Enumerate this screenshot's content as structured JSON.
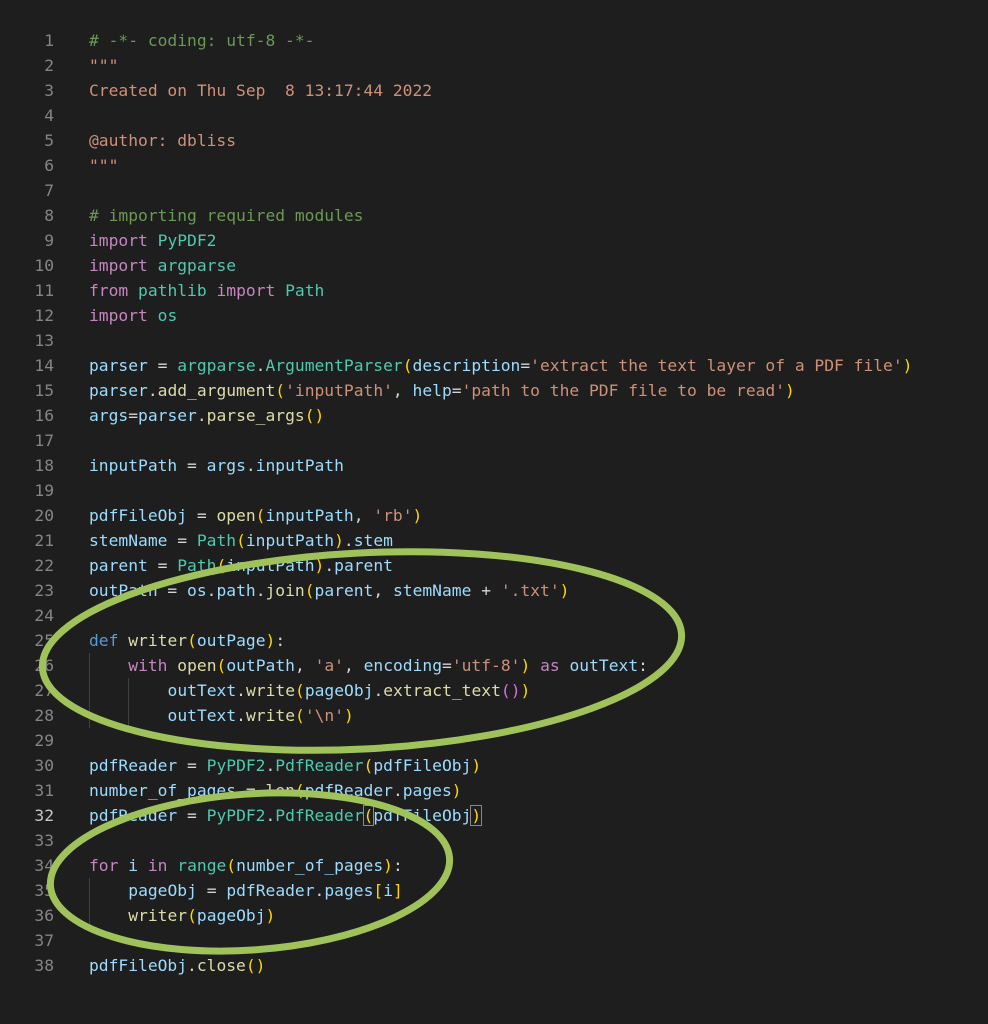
{
  "editor": {
    "active_line": 32,
    "lines": [
      {
        "n": "1",
        "indent": 0,
        "t": [
          [
            "# -*- coding: utf-8 -*-",
            "comment"
          ]
        ]
      },
      {
        "n": "2",
        "indent": 0,
        "t": [
          [
            "\"\"\"",
            "str"
          ]
        ]
      },
      {
        "n": "3",
        "indent": 0,
        "t": [
          [
            "Created on Thu Sep  8 13:17:44 2022",
            "str"
          ]
        ]
      },
      {
        "n": "4",
        "indent": 0,
        "t": []
      },
      {
        "n": "5",
        "indent": 0,
        "t": [
          [
            "@author: dbliss",
            "str"
          ]
        ]
      },
      {
        "n": "6",
        "indent": 0,
        "t": [
          [
            "\"\"\"",
            "str"
          ]
        ]
      },
      {
        "n": "7",
        "indent": 0,
        "t": []
      },
      {
        "n": "8",
        "indent": 0,
        "t": [
          [
            "# importing required modules",
            "comment"
          ]
        ]
      },
      {
        "n": "9",
        "indent": 0,
        "t": [
          [
            "import",
            "kw"
          ],
          [
            " ",
            "op"
          ],
          [
            "PyPDF2",
            "mod"
          ]
        ]
      },
      {
        "n": "10",
        "indent": 0,
        "t": [
          [
            "import",
            "kw"
          ],
          [
            " ",
            "op"
          ],
          [
            "argparse",
            "mod"
          ]
        ]
      },
      {
        "n": "11",
        "indent": 0,
        "t": [
          [
            "from",
            "kw"
          ],
          [
            " ",
            "op"
          ],
          [
            "pathlib",
            "mod"
          ],
          [
            " ",
            "op"
          ],
          [
            "import",
            "kw"
          ],
          [
            " ",
            "op"
          ],
          [
            "Path",
            "mod"
          ]
        ]
      },
      {
        "n": "12",
        "indent": 0,
        "t": [
          [
            "import",
            "kw"
          ],
          [
            " ",
            "op"
          ],
          [
            "os",
            "mod"
          ]
        ]
      },
      {
        "n": "13",
        "indent": 0,
        "t": []
      },
      {
        "n": "14",
        "indent": 0,
        "t": [
          [
            "parser",
            "var"
          ],
          [
            " = ",
            "op"
          ],
          [
            "argparse",
            "mod"
          ],
          [
            ".",
            "op"
          ],
          [
            "ArgumentParser",
            "mod"
          ],
          [
            "(",
            "p1"
          ],
          [
            "description",
            "var"
          ],
          [
            "=",
            "op"
          ],
          [
            "'extract the text layer of a PDF file'",
            "str"
          ],
          [
            ")",
            "p1"
          ]
        ]
      },
      {
        "n": "15",
        "indent": 0,
        "t": [
          [
            "parser",
            "var"
          ],
          [
            ".",
            "op"
          ],
          [
            "add_argument",
            "fn"
          ],
          [
            "(",
            "p1"
          ],
          [
            "'inputPath'",
            "str"
          ],
          [
            ", ",
            "op"
          ],
          [
            "help",
            "var"
          ],
          [
            "=",
            "op"
          ],
          [
            "'path to the PDF file to be read'",
            "str"
          ],
          [
            ")",
            "p1"
          ]
        ]
      },
      {
        "n": "16",
        "indent": 0,
        "t": [
          [
            "args",
            "var"
          ],
          [
            "=",
            "op"
          ],
          [
            "parser",
            "var"
          ],
          [
            ".",
            "op"
          ],
          [
            "parse_args",
            "fn"
          ],
          [
            "()",
            "p1"
          ]
        ]
      },
      {
        "n": "17",
        "indent": 0,
        "t": []
      },
      {
        "n": "18",
        "indent": 0,
        "t": [
          [
            "inputPath",
            "var"
          ],
          [
            " = ",
            "op"
          ],
          [
            "args",
            "var"
          ],
          [
            ".",
            "op"
          ],
          [
            "inputPath",
            "var"
          ]
        ]
      },
      {
        "n": "19",
        "indent": 0,
        "t": []
      },
      {
        "n": "20",
        "indent": 0,
        "t": [
          [
            "pdfFileObj",
            "var"
          ],
          [
            " = ",
            "op"
          ],
          [
            "open",
            "fn"
          ],
          [
            "(",
            "p1"
          ],
          [
            "inputPath",
            "var"
          ],
          [
            ", ",
            "op"
          ],
          [
            "'rb'",
            "str"
          ],
          [
            ")",
            "p1"
          ]
        ]
      },
      {
        "n": "21",
        "indent": 0,
        "t": [
          [
            "stemName",
            "var"
          ],
          [
            " = ",
            "op"
          ],
          [
            "Path",
            "mod"
          ],
          [
            "(",
            "p1"
          ],
          [
            "inputPath",
            "var"
          ],
          [
            ")",
            "p1"
          ],
          [
            ".",
            "op"
          ],
          [
            "stem",
            "var"
          ]
        ]
      },
      {
        "n": "22",
        "indent": 0,
        "t": [
          [
            "parent",
            "var"
          ],
          [
            " = ",
            "op"
          ],
          [
            "Path",
            "mod"
          ],
          [
            "(",
            "p1"
          ],
          [
            "inputPath",
            "var"
          ],
          [
            ")",
            "p1"
          ],
          [
            ".",
            "op"
          ],
          [
            "parent",
            "var"
          ]
        ]
      },
      {
        "n": "23",
        "indent": 0,
        "t": [
          [
            "outPath",
            "var"
          ],
          [
            " = ",
            "op"
          ],
          [
            "os",
            "var"
          ],
          [
            ".",
            "op"
          ],
          [
            "path",
            "var"
          ],
          [
            ".",
            "op"
          ],
          [
            "join",
            "fn"
          ],
          [
            "(",
            "p1"
          ],
          [
            "parent",
            "var"
          ],
          [
            ", ",
            "op"
          ],
          [
            "stemName",
            "var"
          ],
          [
            " + ",
            "op"
          ],
          [
            "'.txt'",
            "str"
          ],
          [
            ")",
            "p1"
          ]
        ]
      },
      {
        "n": "24",
        "indent": 0,
        "t": []
      },
      {
        "n": "25",
        "indent": 0,
        "t": [
          [
            "def",
            "def"
          ],
          [
            " ",
            "op"
          ],
          [
            "writer",
            "fn"
          ],
          [
            "(",
            "p1"
          ],
          [
            "outPage",
            "var"
          ],
          [
            ")",
            "p1"
          ],
          [
            ":",
            "op"
          ]
        ]
      },
      {
        "n": "26",
        "indent": 1,
        "t": [
          [
            "with",
            "kw"
          ],
          [
            " ",
            "op"
          ],
          [
            "open",
            "fn"
          ],
          [
            "(",
            "p1"
          ],
          [
            "outPath",
            "var"
          ],
          [
            ", ",
            "op"
          ],
          [
            "'a'",
            "str"
          ],
          [
            ", ",
            "op"
          ],
          [
            "encoding",
            "var"
          ],
          [
            "=",
            "op"
          ],
          [
            "'utf-8'",
            "str"
          ],
          [
            ")",
            "p1"
          ],
          [
            " ",
            "op"
          ],
          [
            "as",
            "kw"
          ],
          [
            " ",
            "op"
          ],
          [
            "outText",
            "var"
          ],
          [
            ":",
            "op"
          ]
        ]
      },
      {
        "n": "27",
        "indent": 2,
        "t": [
          [
            "outText",
            "var"
          ],
          [
            ".",
            "op"
          ],
          [
            "write",
            "fn"
          ],
          [
            "(",
            "p1"
          ],
          [
            "pageObj",
            "var"
          ],
          [
            ".",
            "op"
          ],
          [
            "extract_text",
            "fn"
          ],
          [
            "()",
            "p2"
          ],
          [
            ")",
            "p1"
          ]
        ]
      },
      {
        "n": "28",
        "indent": 2,
        "t": [
          [
            "outText",
            "var"
          ],
          [
            ".",
            "op"
          ],
          [
            "write",
            "fn"
          ],
          [
            "(",
            "p1"
          ],
          [
            "'\\n'",
            "str"
          ],
          [
            ")",
            "p1"
          ]
        ]
      },
      {
        "n": "29",
        "indent": 0,
        "t": []
      },
      {
        "n": "30",
        "indent": 0,
        "t": [
          [
            "pdfReader",
            "var"
          ],
          [
            " = ",
            "op"
          ],
          [
            "PyPDF2",
            "mod"
          ],
          [
            ".",
            "op"
          ],
          [
            "PdfReader",
            "mod"
          ],
          [
            "(",
            "p1"
          ],
          [
            "pdfFileObj",
            "var"
          ],
          [
            ")",
            "p1"
          ]
        ]
      },
      {
        "n": "31",
        "indent": 0,
        "t": [
          [
            "number_of_pages",
            "var"
          ],
          [
            " = ",
            "op"
          ],
          [
            "len",
            "fn"
          ],
          [
            "(",
            "p1"
          ],
          [
            "pdfReader",
            "var"
          ],
          [
            ".",
            "op"
          ],
          [
            "pages",
            "var"
          ],
          [
            ")",
            "p1"
          ]
        ]
      },
      {
        "n": "32",
        "indent": 0,
        "t": [
          [
            "pdfReader",
            "var"
          ],
          [
            " = ",
            "op"
          ],
          [
            "PyPDF2",
            "mod"
          ],
          [
            ".",
            "op"
          ],
          [
            "PdfReader",
            "mod"
          ],
          [
            "(",
            "p1bm"
          ],
          [
            "pdfFileObj",
            "var"
          ],
          [
            ")",
            "p1bm"
          ]
        ]
      },
      {
        "n": "33",
        "indent": 0,
        "t": []
      },
      {
        "n": "34",
        "indent": 0,
        "t": [
          [
            "for",
            "kw"
          ],
          [
            " ",
            "op"
          ],
          [
            "i",
            "var"
          ],
          [
            " ",
            "op"
          ],
          [
            "in",
            "kw"
          ],
          [
            " ",
            "op"
          ],
          [
            "range",
            "mod"
          ],
          [
            "(",
            "p1"
          ],
          [
            "number_of_pages",
            "var"
          ],
          [
            ")",
            "p1"
          ],
          [
            ":",
            "op"
          ]
        ]
      },
      {
        "n": "35",
        "indent": 1,
        "t": [
          [
            "pageObj",
            "var"
          ],
          [
            " = ",
            "op"
          ],
          [
            "pdfReader",
            "var"
          ],
          [
            ".",
            "op"
          ],
          [
            "pages",
            "var"
          ],
          [
            "[",
            "p1"
          ],
          [
            "i",
            "var"
          ],
          [
            "]",
            "p1"
          ]
        ]
      },
      {
        "n": "36",
        "indent": 1,
        "t": [
          [
            "writer",
            "fn"
          ],
          [
            "(",
            "p1"
          ],
          [
            "pageObj",
            "var"
          ],
          [
            ")",
            "p1"
          ]
        ]
      },
      {
        "n": "37",
        "indent": 0,
        "t": []
      },
      {
        "n": "38",
        "indent": 0,
        "t": [
          [
            "pdfFileObj",
            "var"
          ],
          [
            ".",
            "op"
          ],
          [
            "close",
            "fn"
          ],
          [
            "()",
            "p1"
          ]
        ]
      }
    ]
  },
  "annotations": {
    "color": "#9fc35a",
    "items": [
      {
        "label": "writer-function-highlight"
      },
      {
        "label": "for-loop-highlight"
      }
    ]
  }
}
